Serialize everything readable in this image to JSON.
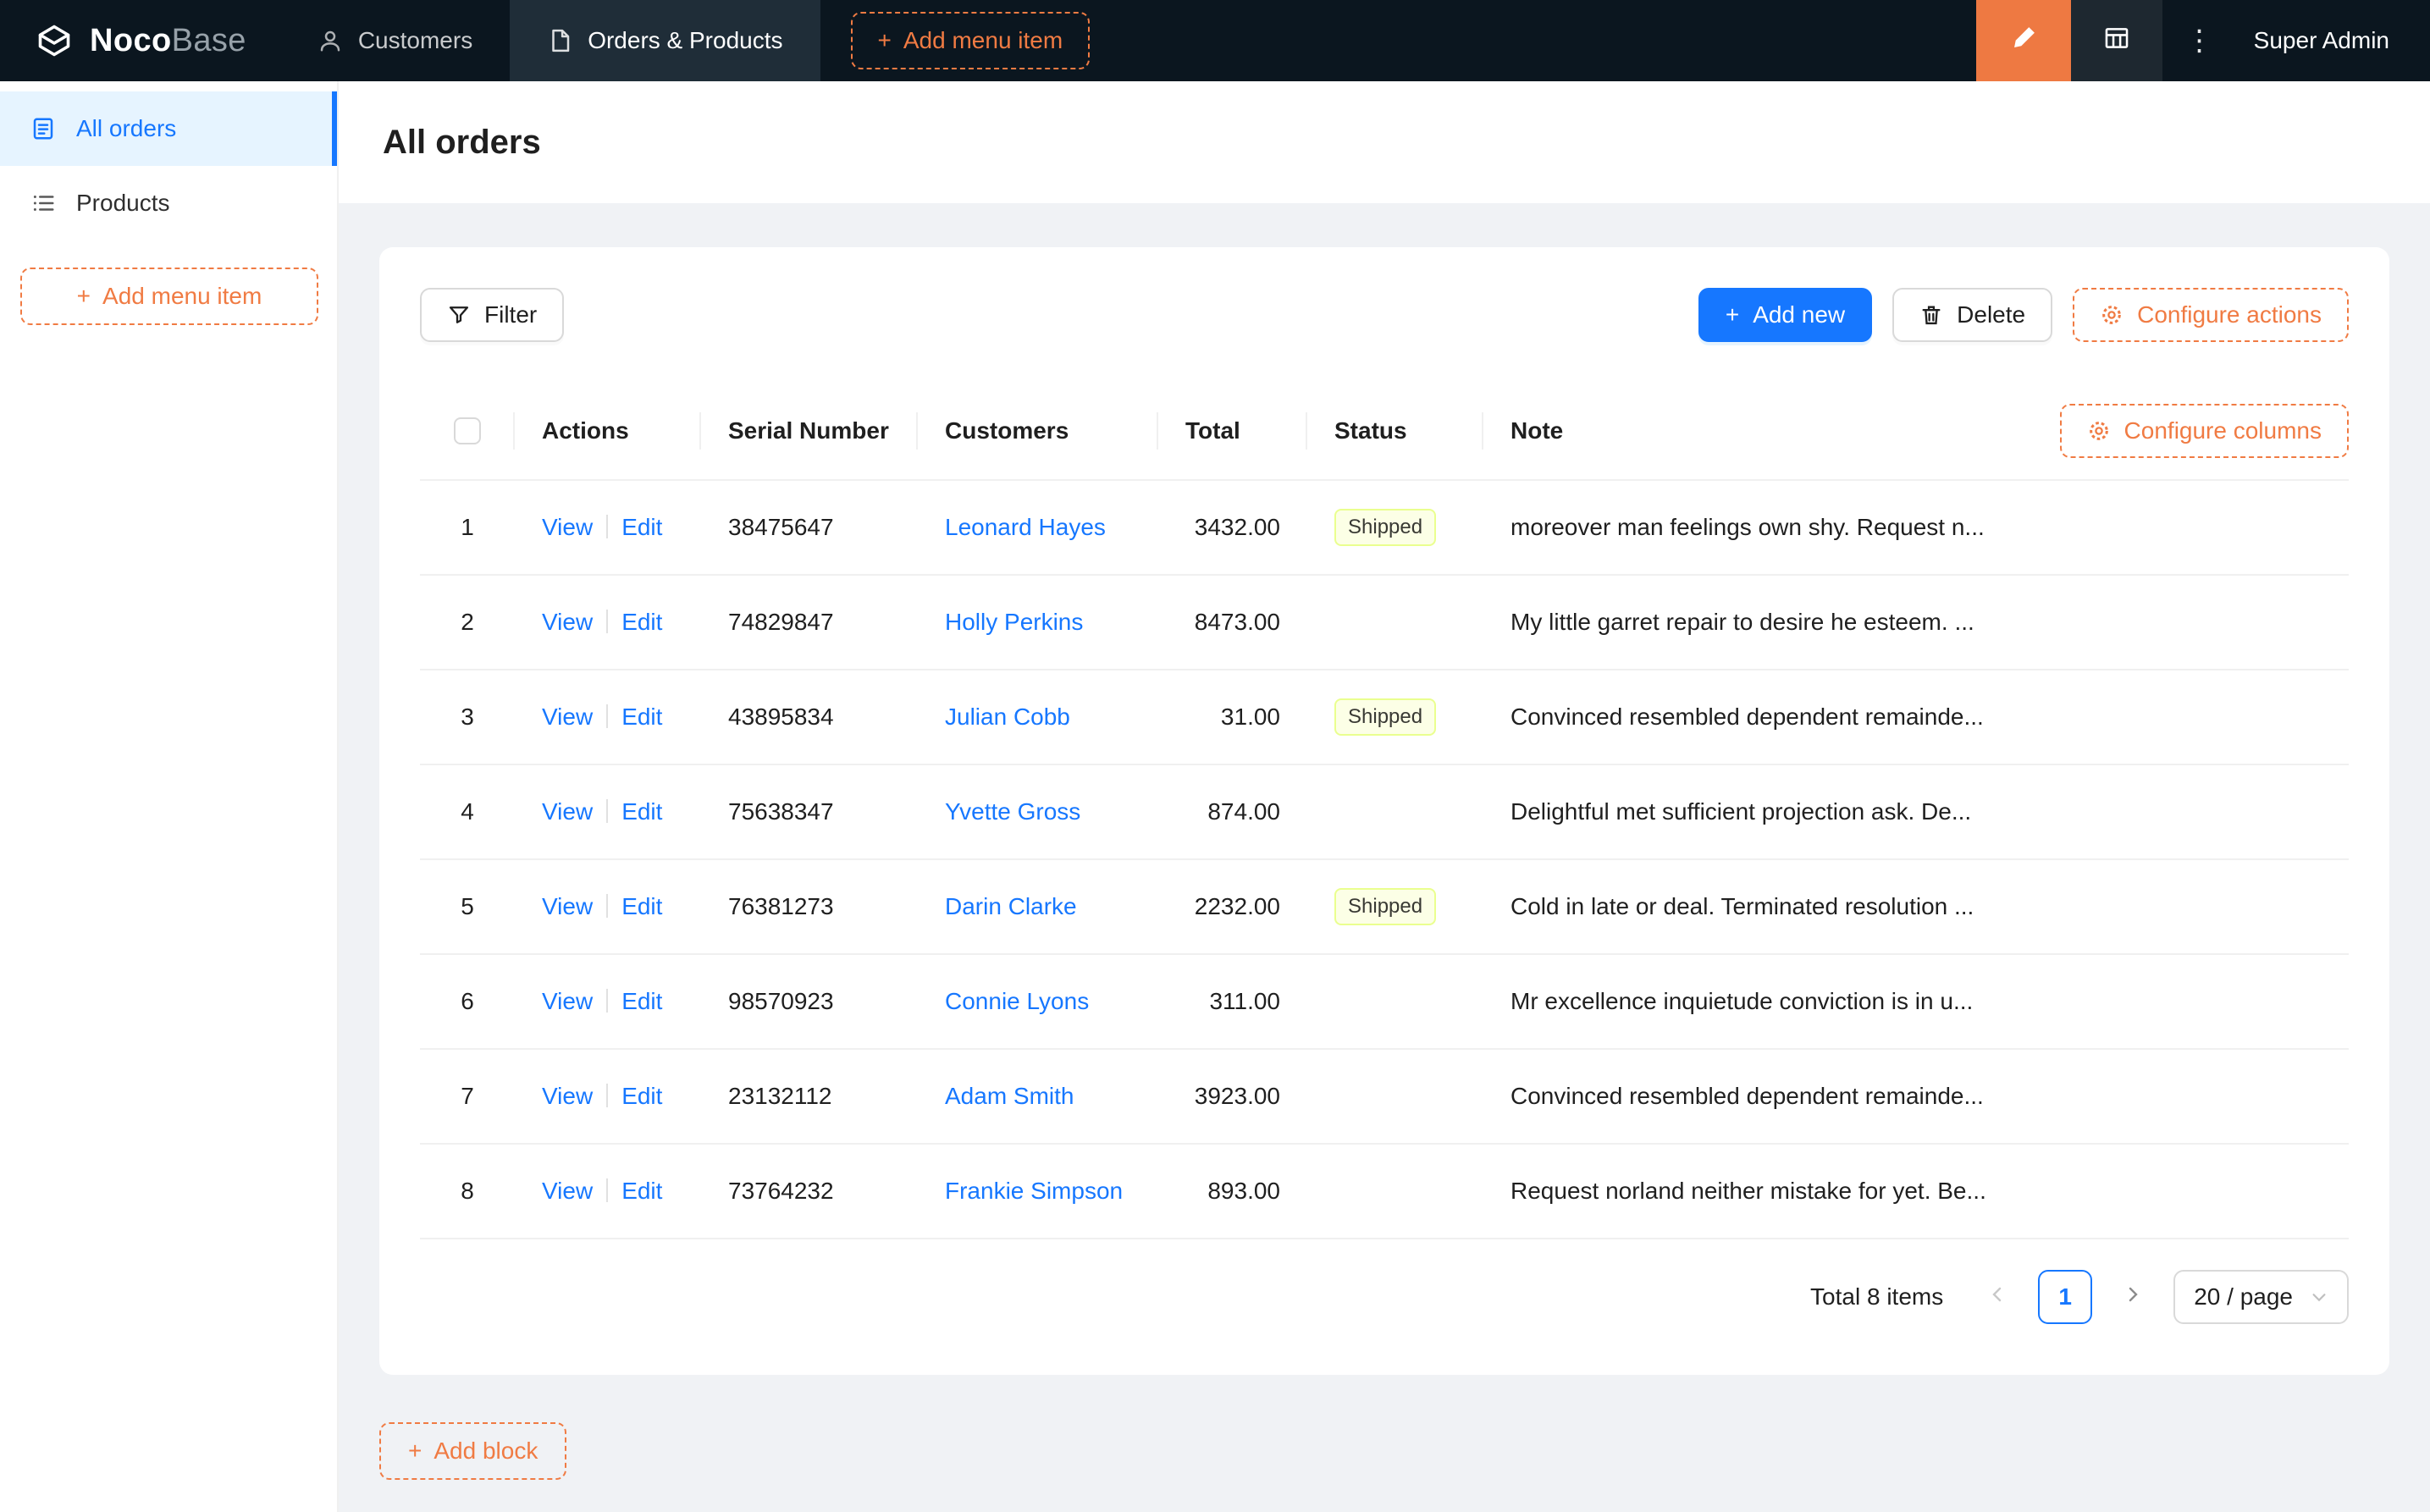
{
  "colors": {
    "primary": "#1677ff",
    "settings_orange": "#f07b43",
    "designer_bg": "#ee7942",
    "nav_bg": "#0b161f",
    "nav_active": "#1f2d38",
    "content_bg": "#f0f2f5",
    "tag_bg": "#fcffe6",
    "tag_border": "#eaff8f"
  },
  "icons": {
    "plus": "+",
    "more_vertical": "⋮"
  },
  "topnav": {
    "logo": {
      "noco": "Noco",
      "base": "Base"
    },
    "items": [
      {
        "label": "Customers",
        "active": false
      },
      {
        "label": "Orders & Products",
        "active": true
      }
    ],
    "add_menu_item": "Add menu item",
    "user": "Super Admin"
  },
  "sidebar": {
    "items": [
      {
        "label": "All orders",
        "active": true
      },
      {
        "label": "Products",
        "active": false
      }
    ],
    "add_menu_item": "Add menu item"
  },
  "page": {
    "title": "All orders"
  },
  "toolbar": {
    "filter": "Filter",
    "add_new": "Add new",
    "delete": "Delete",
    "configure_actions": "Configure actions"
  },
  "table": {
    "configure_columns": "Configure columns",
    "columns": [
      "Actions",
      "Serial Number",
      "Customers",
      "Total",
      "Status",
      "Note"
    ],
    "action_labels": {
      "view": "View",
      "edit": "Edit"
    },
    "rows": [
      {
        "index": 1,
        "serial": "38475647",
        "customer": "Leonard Hayes",
        "total": "3432.00",
        "status": "Shipped",
        "note": "moreover man feelings own shy. Request n..."
      },
      {
        "index": 2,
        "serial": "74829847",
        "customer": "Holly Perkins",
        "total": "8473.00",
        "status": "",
        "note": "My little garret repair to desire he esteem. ..."
      },
      {
        "index": 3,
        "serial": "43895834",
        "customer": "Julian Cobb",
        "total": "31.00",
        "status": "Shipped",
        "note": "Convinced resembled dependent remainde..."
      },
      {
        "index": 4,
        "serial": "75638347",
        "customer": "Yvette Gross",
        "total": "874.00",
        "status": "",
        "note": "Delightful met sufficient projection ask. De..."
      },
      {
        "index": 5,
        "serial": "76381273",
        "customer": "Darin Clarke",
        "total": "2232.00",
        "status": "Shipped",
        "note": "Cold in late or deal. Terminated resolution ..."
      },
      {
        "index": 6,
        "serial": "98570923",
        "customer": "Connie Lyons",
        "total": "311.00",
        "status": "",
        "note": "Mr excellence inquietude conviction is in u..."
      },
      {
        "index": 7,
        "serial": "23132112",
        "customer": "Adam Smith",
        "total": "3923.00",
        "status": "",
        "note": "Convinced resembled dependent remainde..."
      },
      {
        "index": 8,
        "serial": "73764232",
        "customer": "Frankie Simpson",
        "total": "893.00",
        "status": "",
        "note": "Request norland neither mistake for yet. Be..."
      }
    ]
  },
  "pagination": {
    "total_text": "Total 8 items",
    "current_page": "1",
    "page_size": "20 / page"
  },
  "add_block": "Add block"
}
